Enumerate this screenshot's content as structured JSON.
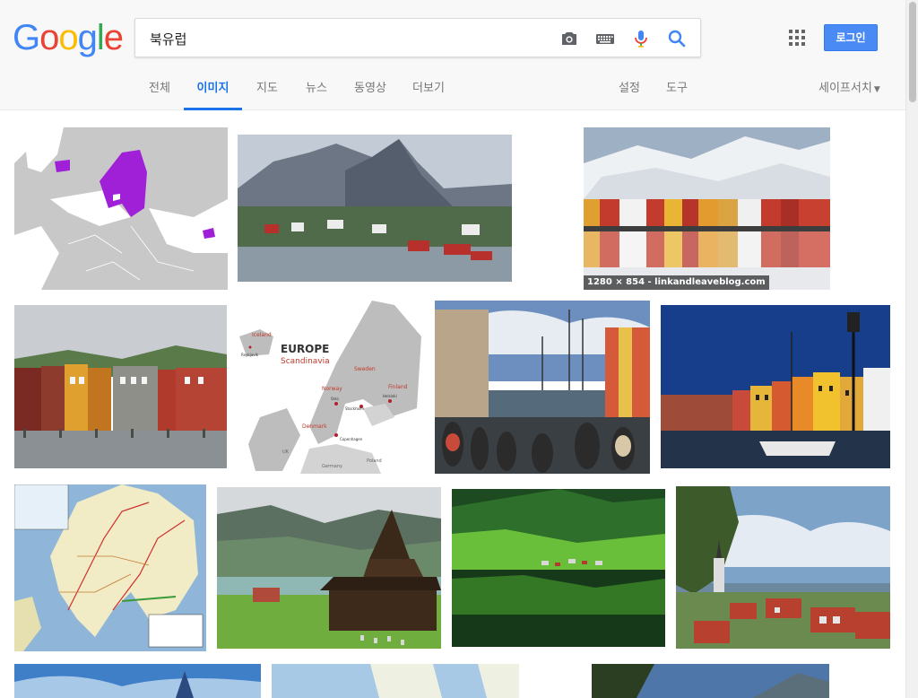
{
  "logo": {
    "letters": [
      "G",
      "o",
      "o",
      "g",
      "l",
      "e"
    ],
    "colors": [
      "#4285f4",
      "#ea4335",
      "#fbbc05",
      "#4285f4",
      "#34a853",
      "#ea4335"
    ]
  },
  "search": {
    "query": "북유럽"
  },
  "header": {
    "login_label": "로그인"
  },
  "tabs": [
    {
      "label": "전체"
    },
    {
      "label": "이미지"
    },
    {
      "label": "지도"
    },
    {
      "label": "뉴스"
    },
    {
      "label": "동영상"
    },
    {
      "label": "더보기"
    },
    {
      "label": "설정"
    },
    {
      "label": "도구"
    }
  ],
  "safe_search": {
    "label": "세이프서치"
  },
  "accent_color": "#1a73e8",
  "results": [
    {
      "caption": ""
    },
    {
      "caption": ""
    },
    {
      "caption": "1280 × 854 - linkandleaveblog.com"
    },
    {
      "caption": ""
    },
    {
      "caption": "",
      "map_texts": {
        "title": "EUROPE",
        "subtitle": "Scandinavia",
        "iceland": "Iceland",
        "norway": "Norway",
        "sweden": "Sweden",
        "finland": "Finland",
        "denmark": "Denmark",
        "germany": "Germany",
        "poland": "Poland",
        "uk": "UK",
        "oslo": "Oslo",
        "stockholm": "Stockholm",
        "helsinki": "Helsinki",
        "copenhagen": "Copenhagen",
        "reykjavik": "Reykjavík"
      }
    },
    {
      "caption": ""
    },
    {
      "caption": ""
    },
    {
      "caption": ""
    },
    {
      "caption": ""
    },
    {
      "caption": ""
    },
    {
      "caption": ""
    },
    {
      "caption": ""
    },
    {
      "caption": ""
    },
    {
      "caption": ""
    }
  ]
}
